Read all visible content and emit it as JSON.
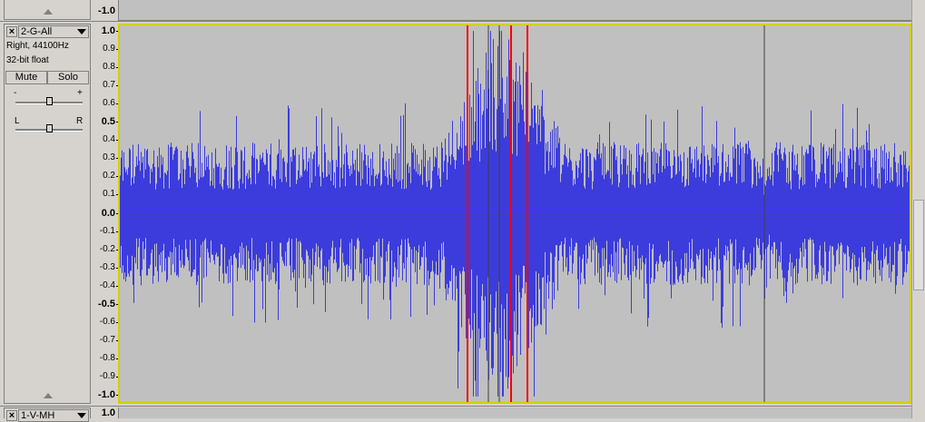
{
  "top_track": {
    "ruler_bottom_label": "-1.0"
  },
  "track": {
    "name": "2-G-All",
    "info_line1": "Right, 44100Hz",
    "info_line2": "32-bit float",
    "mute_label": "Mute",
    "solo_label": "Solo",
    "gain_minus": "-",
    "gain_plus": "+",
    "pan_left": "L",
    "pan_right": "R",
    "gain_level": 0.5,
    "pan_level": 0.5,
    "ruler_ticks": [
      "1.0",
      "0.9",
      "0.8",
      "0.7",
      "0.6",
      "0.5",
      "0.4",
      "0.3",
      "0.2",
      "0.1",
      "0.0",
      "-0.1",
      "-0.2",
      "-0.3",
      "-0.4",
      "-0.5",
      "-0.6",
      "-0.7",
      "-0.8",
      "-0.9",
      "-1.0"
    ],
    "waveform_color": "#3c3cdc",
    "background_color": "#c0c0c0",
    "selection_border_color": "#d4d000",
    "marker_color": "#ff0000"
  },
  "bottom_track": {
    "name": "1-V-MH",
    "ruler_top_label": "1.0"
  }
}
